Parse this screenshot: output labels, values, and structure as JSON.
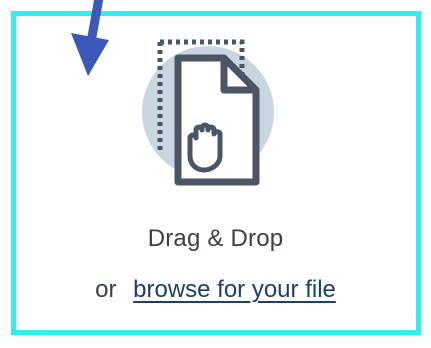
{
  "dropzone": {
    "title": "Drag & Drop",
    "or_text": "or",
    "browse_link": "browse for your file"
  },
  "icons": {
    "arrow": "arrow-down-left-icon",
    "file": "file-drag-hand-icon"
  },
  "colors": {
    "border": "#2ff0f0",
    "arrow": "#3b5ab8",
    "icon_bg": "#c9d6df",
    "icon_stroke": "#4b5563",
    "text": "#3a3f48",
    "link": "#1e3f66"
  }
}
